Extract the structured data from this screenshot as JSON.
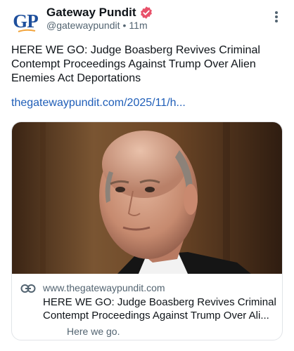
{
  "author": {
    "avatar_text": "GP",
    "name": "Gateway Pundit",
    "verified": true,
    "handle": "@gatewaypundit",
    "separator": "•",
    "time": "11m"
  },
  "post": {
    "text": "HERE WE GO: Judge Boasberg Revives Criminal Contempt Proceedings Against Trump Over Alien Enemies Act Deportations",
    "link_text": "thegatewaypundit.com/2025/11/h..."
  },
  "card": {
    "domain": "www.thegatewaypundit.com",
    "title_line1": "HERE WE GO: Judge Boasberg Revives Criminal",
    "title_line2": "Contempt Proceedings Against Trump Over Ali...",
    "description": "Here we go."
  },
  "icons": {
    "more": "more-vertical-icon",
    "verified": "verified-badge-icon",
    "link": "link-icon"
  },
  "colors": {
    "brand_blue": "#1e4f9c",
    "link": "#1f5eb8",
    "verified": "#e8516a",
    "muted": "#536471"
  }
}
